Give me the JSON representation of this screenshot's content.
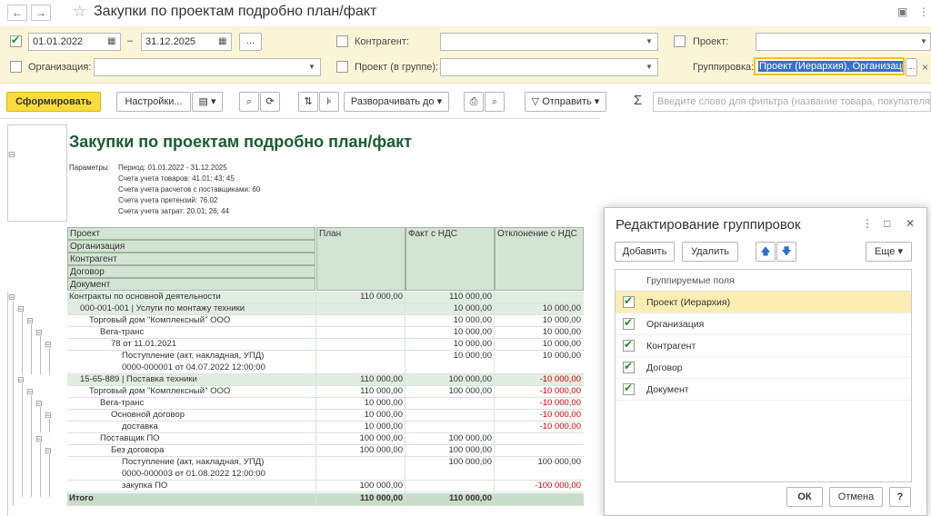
{
  "window": {
    "title": "Закупки по проектам подробно план/факт"
  },
  "filters": {
    "date_from": "01.01.2022",
    "date_sep": "–",
    "date_to": "31.12.2025",
    "ellipsis": "...",
    "org_label": "Организация:",
    "org_value": "",
    "counterparty_label": "Контрагент:",
    "project_group_label": "Проект (в группе):",
    "project_label": "Проект:",
    "grouping_label": "Группировка:",
    "grouping_value": "Проект (Иерархия), Организация",
    "clear": "×"
  },
  "toolbar": {
    "generate": "Сформировать",
    "settings": "Настройки...",
    "expand_to": "Разворачивать до",
    "send": "Отправить",
    "sigma": "Σ",
    "search_placeholder": "Введите слово для фильтра (название товара, покупателя и п"
  },
  "report": {
    "title": "Закупки по проектам подробно план/факт",
    "params_label": "Параметры:",
    "params": [
      "Период: 01.01.2022 - 31.12.2025",
      "Счета учета товаров: 41.01; 43; 45",
      "Счета учета расчетов с поставщиками: 60",
      "Счета учета претензий: 76.02",
      "Счета учета затрат: 20.01; 26; 44"
    ],
    "headers": {
      "group_levels": [
        "Проект",
        "Организация",
        "Контрагент",
        "Договор",
        "Документ"
      ],
      "plan": "План",
      "fact": "Факт с НДС",
      "dev": "Отклонение с НДС"
    },
    "rows": [
      {
        "label": "Контракты по основной деятельности",
        "plan": "110 000,00",
        "fact": "110 000,00",
        "dev": ""
      },
      {
        "label": "000-001-001 | Услуги по монтажу техники",
        "plan": "",
        "fact": "10 000,00",
        "dev": "10 000,00"
      },
      {
        "label": "Торговый дом \"Комплексный\" ООО",
        "plan": "",
        "fact": "10 000,00",
        "dev": "10 000,00"
      },
      {
        "label": "Вега-транс",
        "plan": "",
        "fact": "10 000,00",
        "dev": "10 000,00"
      },
      {
        "label": "78 от 11.01.2021",
        "plan": "",
        "fact": "10 000,00",
        "dev": "10 000,00"
      },
      {
        "label": "Поступление (акт, накладная, УПД)",
        "label2": "0000-000001 от 04.07.2022 12:00:00",
        "plan": "",
        "fact": "10 000,00",
        "dev": "10 000,00"
      },
      {
        "label": "15-65-889 | Поставка техники",
        "plan": "110 000,00",
        "fact": "100 000,00",
        "dev": "-10 000,00"
      },
      {
        "label": "Торговый дом \"Комплексный\" ООО",
        "plan": "110 000,00",
        "fact": "100 000,00",
        "dev": "-10 000,00"
      },
      {
        "label": "Вега-транс",
        "plan": "10 000,00",
        "fact": "",
        "dev": "-10 000,00"
      },
      {
        "label": "Основной договор",
        "plan": "10 000,00",
        "fact": "",
        "dev": "-10 000,00"
      },
      {
        "label": "доставка",
        "plan": "10 000,00",
        "fact": "",
        "dev": "-10 000,00"
      },
      {
        "label": "Поставщик ПО",
        "plan": "100 000,00",
        "fact": "100 000,00",
        "dev": ""
      },
      {
        "label": "Без договора",
        "plan": "100 000,00",
        "fact": "100 000,00",
        "dev": ""
      },
      {
        "label": "Поступление (акт, накладная, УПД)",
        "label2": "0000-000003 от 01.08.2022 12:00:00",
        "plan": "",
        "fact": "100 000,00",
        "dev": "100 000,00"
      },
      {
        "label": "закупка ПО",
        "plan": "100 000,00",
        "fact": "",
        "dev": "-100 000,00"
      }
    ],
    "total": {
      "label": "Итого",
      "plan": "110 000,00",
      "fact": "110 000,00",
      "dev": ""
    }
  },
  "dialog": {
    "title": "Редактирование группировок",
    "add": "Добавить",
    "remove": "Удалить",
    "more": "Еще",
    "list_header": "Группируемые поля",
    "items": [
      "Проект (Иерархия)",
      "Организация",
      "Контрагент",
      "Договор",
      "Документ"
    ],
    "ok": "ОК",
    "cancel": "Отмена",
    "help": "?"
  },
  "colors": {
    "accent": "#fbdc3d",
    "report_title": "#1b5c32",
    "negative": "#dd0000",
    "header_bg": "#d4e4d4",
    "filter_bg": "#fbf5d8"
  }
}
